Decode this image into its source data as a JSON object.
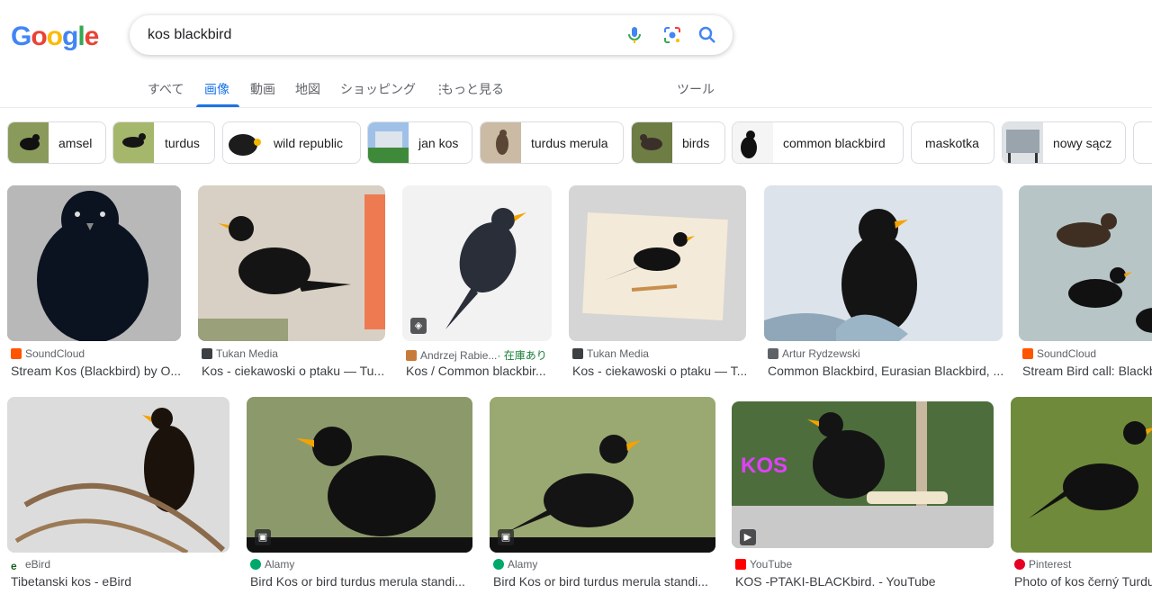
{
  "logo": {
    "letters": [
      "G",
      "o",
      "o",
      "g",
      "l",
      "e"
    ]
  },
  "search": {
    "query": "kos blackbird"
  },
  "tabs": {
    "all": "すべて",
    "images": "画像",
    "videos": "動画",
    "maps": "地図",
    "shopping": "ショッピング",
    "more": "もっと見る",
    "tools": "ツール"
  },
  "chips": [
    "amsel",
    "turdus",
    "wild republic",
    "jan kos",
    "turdus merula",
    "birds",
    "common blackbird",
    "maskotka",
    "nowy sącz"
  ],
  "results": [
    {
      "source": "SoundCloud",
      "title": "Stream Kos (Blackbird) by O..."
    },
    {
      "source": "Tukan Media",
      "title": "Kos - ciekawoski o ptaku — Tu..."
    },
    {
      "source": "Andrzej Rabie...",
      "stock": "· 在庫あり",
      "title": "Kos / Common blackbir..."
    },
    {
      "source": "Tukan Media",
      "title": "Kos - ciekawoski o ptaku — T..."
    },
    {
      "source": "Artur Rydzewski",
      "title": "Common Blackbird, Eurasian Blackbird, ..."
    },
    {
      "source": "SoundCloud",
      "title": "Stream Bird call: Blackb"
    },
    {
      "source": "eBird",
      "title": "Tibetanski kos - eBird"
    },
    {
      "source": "Alamy",
      "title": "Bird Kos or bird turdus merula standi..."
    },
    {
      "source": "Alamy",
      "title": "Bird Kos or bird turdus merula standi..."
    },
    {
      "source": "YouTube",
      "title": "KOS -PTAKI-BLACKbird. - YouTube",
      "overlay": "KOS"
    },
    {
      "source": "Pinterest",
      "title": "Photo of kos černý Turdu"
    }
  ],
  "colors": {
    "accent": "#1a73e8",
    "stock": "#188038",
    "soundcloud": "#ff5500",
    "youtube": "#ff0000",
    "pinterest": "#e60023",
    "alamy": "#00a86b",
    "ebird": "#1b5e20"
  },
  "icons": {
    "mic": "mic-icon",
    "lens": "lens-icon",
    "search": "search-icon",
    "more": "more-vert-icon"
  }
}
